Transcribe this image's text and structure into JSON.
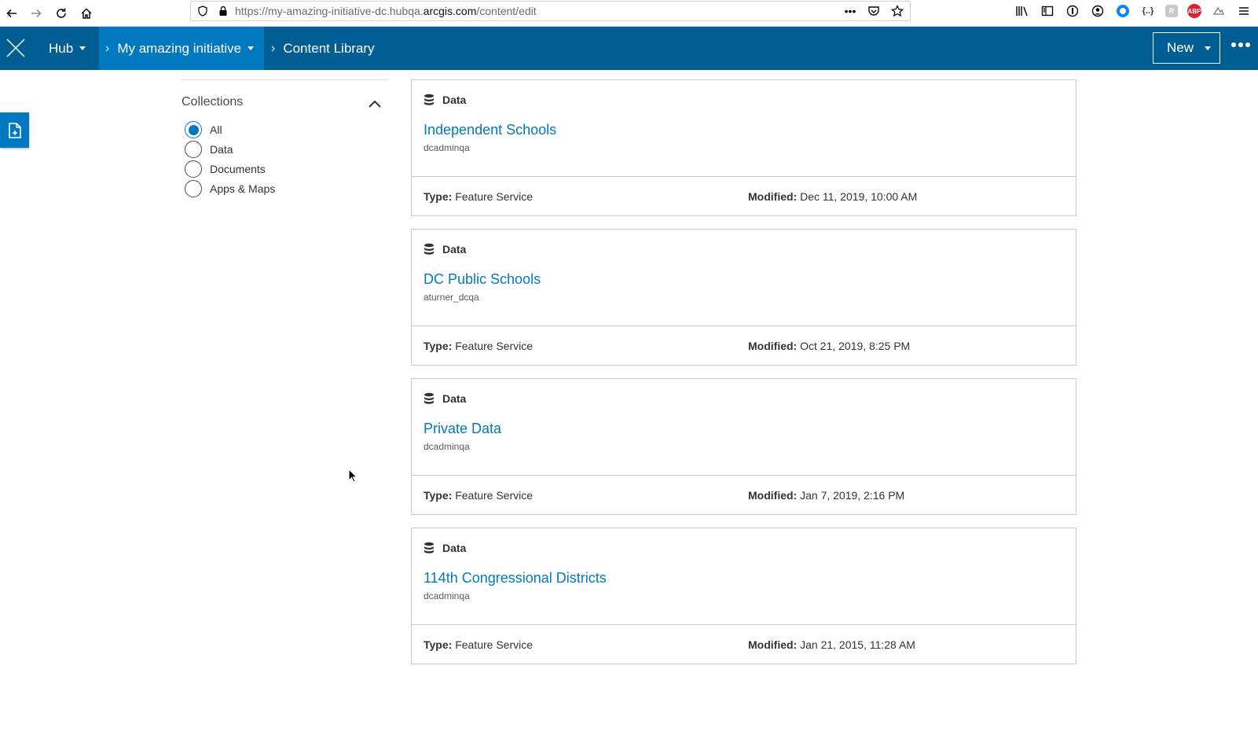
{
  "browser": {
    "url_prefix": "https://my-amazing-initiative-dc.hubqa.",
    "url_domain": "arcgis.com",
    "url_path": "/content/edit",
    "page_actions_label": "•••",
    "abp_label": "ABP",
    "curly_ext_label": "{..}"
  },
  "header": {
    "hub_label": "Hub",
    "initiative_label": "My amazing initiative",
    "library_label": "Content Library",
    "chevron": "›",
    "new_label": "New"
  },
  "filters": {
    "title": "Collections",
    "options": [
      {
        "label": "All",
        "checked": true
      },
      {
        "label": "Data",
        "checked": false
      },
      {
        "label": "Documents",
        "checked": false
      },
      {
        "label": "Apps & Maps",
        "checked": false
      }
    ]
  },
  "cards": [
    {
      "category": "Data",
      "title": "Independent Schools",
      "owner": "dcadminqa",
      "type_label": "Type:",
      "type": "Feature Service",
      "modified_label": "Modified:",
      "modified": "Dec 11, 2019, 10:00 AM"
    },
    {
      "category": "Data",
      "title": "DC Public Schools",
      "owner": "aturner_dcqa",
      "type_label": "Type:",
      "type": "Feature Service",
      "modified_label": "Modified:",
      "modified": "Oct 21, 2019, 8:25 PM"
    },
    {
      "category": "Data",
      "title": "Private Data",
      "owner": "dcadminqa",
      "type_label": "Type:",
      "type": "Feature Service",
      "modified_label": "Modified:",
      "modified": "Jan 7, 2019, 2:16 PM"
    },
    {
      "category": "Data",
      "title": "114th Congressional Districts",
      "owner": "dcadminqa",
      "type_label": "Type:",
      "type": "Feature Service",
      "modified_label": "Modified:",
      "modified": "Jan 21, 2015, 11:28 AM"
    }
  ],
  "colors": {
    "header_bg": "#005e95",
    "active_crumb_bg": "#0079c1",
    "link": "#0079c1"
  }
}
